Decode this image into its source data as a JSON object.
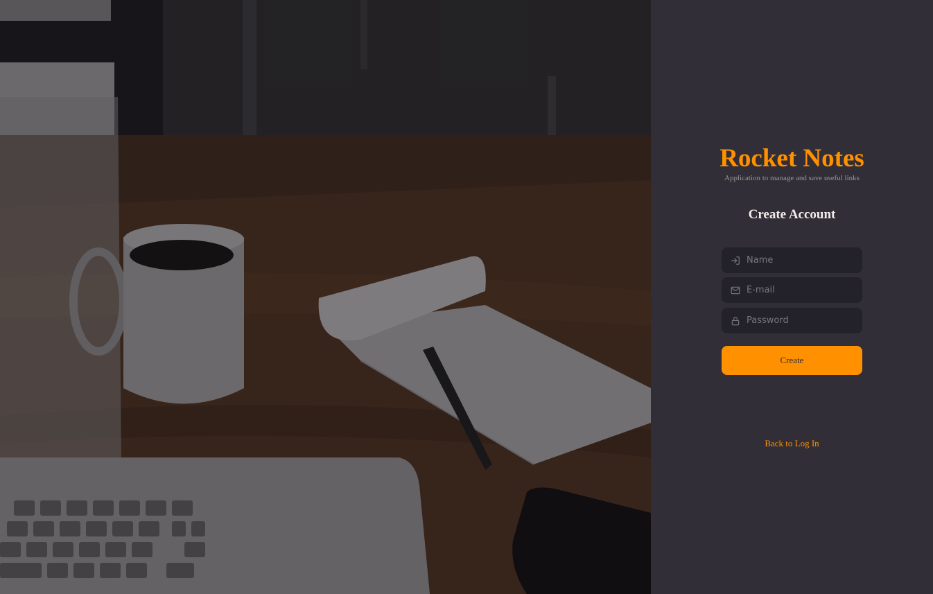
{
  "brand": {
    "title": "Rocket Notes",
    "subtitle": "Application to manage and save useful links"
  },
  "form": {
    "heading": "Create Account",
    "name_field": {
      "placeholder": "Name",
      "value": "",
      "icon": "log-in-icon"
    },
    "email_field": {
      "placeholder": "E-mail",
      "value": "",
      "icon": "mail-icon"
    },
    "password_field": {
      "placeholder": "Password",
      "value": "",
      "icon": "lock-icon"
    },
    "submit_label": "Create",
    "back_link_label": "Back to Log In"
  },
  "colors": {
    "accent": "#ff9000",
    "panel_background": "#312e38",
    "input_background": "#232129",
    "heading_text": "#f4ede8",
    "muted_text": "#999591"
  },
  "background_image": {
    "icons": [
      "coffee-mug",
      "notepad",
      "pen",
      "laptop",
      "smartphone"
    ]
  }
}
